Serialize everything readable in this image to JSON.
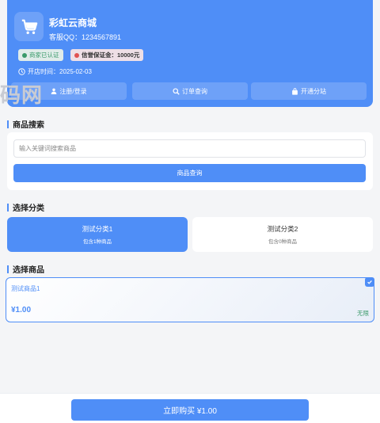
{
  "shop": {
    "name": "彩虹云商城",
    "qq": "客服QQ：1234567891",
    "badge_cert": "商家已认证",
    "badge_deposit": "信誉保证金：10000元",
    "open_time": "开店时间：2025-02-03"
  },
  "header_buttons": {
    "login": "注册/登录",
    "order_query": "订单查询",
    "open_branch": "开通分站"
  },
  "watermark": "码网",
  "search": {
    "title": "商品搜索",
    "placeholder": "输入关键词搜索商品",
    "button": "商品查询"
  },
  "category": {
    "title": "选择分类",
    "items": [
      {
        "name": "测试分类1",
        "count": "包含1种商品"
      },
      {
        "name": "测试分类2",
        "count": "包含0种商品"
      }
    ]
  },
  "product": {
    "title": "选择商品",
    "items": [
      {
        "name": "测试商品1",
        "price": "¥1.00",
        "stock": "无限"
      }
    ]
  },
  "buy_button": "立即购买 ¥1.00",
  "colors": {
    "primary": "#4f8ef7",
    "success": "#3a9a6a"
  },
  "icons": [
    "cart-icon",
    "user-icon",
    "search-icon",
    "bag-icon",
    "clock-icon",
    "check-icon"
  ]
}
